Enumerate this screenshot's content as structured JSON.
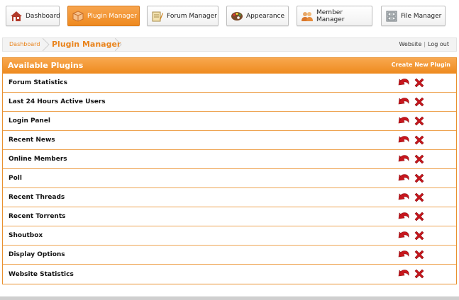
{
  "nav": {
    "items": [
      {
        "label": "Dashboard",
        "icon": "house-icon",
        "active": false
      },
      {
        "label": "Plugin Manager",
        "icon": "boxes-icon",
        "active": true
      },
      {
        "label": "Forum Manager",
        "icon": "pencil-paper-icon",
        "active": false
      },
      {
        "label": "Appearance",
        "icon": "palette-icon",
        "active": false
      },
      {
        "label": "Member Manager",
        "icon": "users-icon",
        "active": false
      },
      {
        "label": "File Manager",
        "icon": "file-cabinet-icon",
        "active": false
      }
    ]
  },
  "breadcrumb": {
    "home": "Dashboard",
    "current": "Plugin Manager",
    "website": "Website",
    "separator": "|",
    "logout": "Log out"
  },
  "panel": {
    "title": "Available Plugins",
    "create_link": "Create New Plugin",
    "plugins": [
      {
        "name": "Forum Statistics"
      },
      {
        "name": "Last 24 Hours Active Users"
      },
      {
        "name": "Login Panel"
      },
      {
        "name": "Recent News"
      },
      {
        "name": "Online Members"
      },
      {
        "name": "Poll"
      },
      {
        "name": "Recent Threads"
      },
      {
        "name": "Recent Torrents"
      },
      {
        "name": "Shoutbox"
      },
      {
        "name": "Display Options"
      },
      {
        "name": "Website Statistics"
      }
    ],
    "action_icons": [
      "undo-arrow-icon",
      "delete-x-icon"
    ]
  },
  "colors": {
    "accent": "#ee8a1e",
    "delete": "#c8161d"
  }
}
